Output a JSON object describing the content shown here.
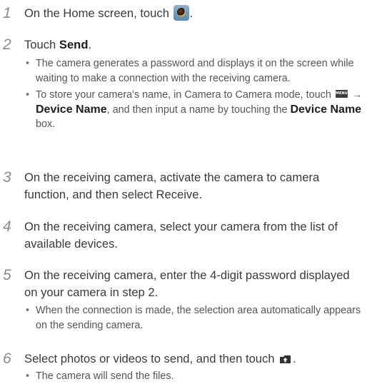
{
  "icons": {
    "camera_app": "camera-app-icon",
    "menu": "menu-icon",
    "menu_text": "MENU",
    "send": "send-upload-icon"
  },
  "steps": [
    {
      "number": "1",
      "pre": "On the Home screen, touch ",
      "post": "."
    },
    {
      "number": "2",
      "pre": "Touch ",
      "bold": "Send",
      "post": ".",
      "bullets": [
        "The camera generates a password and displays it on the screen while waiting to make a connection with the receiving camera.",
        {
          "pre": "To store your camera's name, in Camera to Camera mode, touch ",
          "arrow": " → ",
          "bold1": "Device Name",
          "mid": ", and then input a name by touching the ",
          "bold2": "Device Name",
          "post": " box."
        }
      ]
    },
    {
      "number": "3",
      "text": "On the receiving camera, activate the camera to camera function, and then select Receive."
    },
    {
      "number": "4",
      "text": "On the receiving camera, select your camera from the list of available devices."
    },
    {
      "number": "5",
      "text": "On the receiving camera, enter the 4-digit password displayed on your camera in step 2.",
      "bullets": [
        "When the connection is made, the selection area automatically appears on the sending camera."
      ]
    },
    {
      "number": "6",
      "pre": "Select photos or videos to send, and then touch ",
      "post": ".",
      "bullets": [
        "The camera will send the files."
      ]
    }
  ]
}
